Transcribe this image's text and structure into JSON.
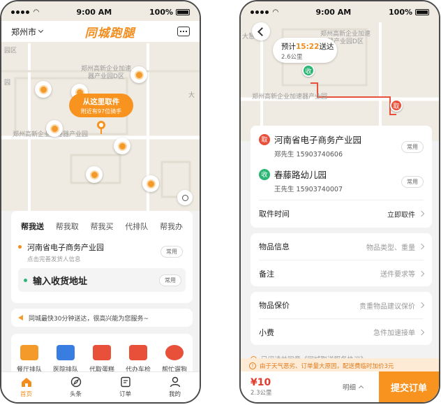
{
  "status": {
    "time": "9:00 AM",
    "battery": "100%"
  },
  "left": {
    "header": {
      "city": "郑州市",
      "brand": "同城跑腿"
    },
    "map": {
      "labels": [
        "郑州高新企业加速器产业园D区",
        "郑州高新企业加速器产业园",
        "园区",
        "园",
        "大"
      ],
      "pickup_title": "从这里取件",
      "pickup_sub": "附近有97位骑手"
    },
    "tabs": [
      "帮我送",
      "帮我取",
      "帮我买",
      "代排队",
      "帮我办"
    ],
    "sender": {
      "address": "河南省电子商务产业园",
      "hint": "点击完善发货人信息",
      "badge": "常用"
    },
    "receiver": {
      "placeholder": "输入收货地址",
      "badge": "常用"
    },
    "notice": "同城最快30分钟送达，很高兴能为您服务~",
    "services": [
      {
        "label": "餐厅排队",
        "color": "#f39a2b"
      },
      {
        "label": "医院排队",
        "color": "#3a7de0"
      },
      {
        "label": "代取蛋糕",
        "color": "#e8503a"
      },
      {
        "label": "代办车检",
        "color": "#e8503a"
      },
      {
        "label": "帮忙遛狗",
        "color": "#e8503a"
      }
    ],
    "nav": [
      {
        "label": "首页",
        "icon": "home-icon"
      },
      {
        "label": "头条",
        "icon": "compass-icon"
      },
      {
        "label": "订单",
        "icon": "order-icon"
      },
      {
        "label": "我的",
        "icon": "user-icon"
      }
    ]
  },
  "right": {
    "map": {
      "labels": [
        "郑州高新企业加速器产业园D区",
        "郑州高新企业加速器产业园",
        "大慧谷"
      ],
      "eta_prefix": "预计",
      "eta_time": "15:22",
      "eta_suffix": "送达",
      "eta_distance": "2.6公里",
      "marker_receive": "收",
      "marker_pickup": "取"
    },
    "pickup": {
      "tag": "取",
      "name": "河南省电子商务产业园",
      "contact": "郑先生   15903740606",
      "badge": "常用"
    },
    "dropoff": {
      "tag": "收",
      "name": "春藤路幼儿园",
      "contact": "王先生   15903740007",
      "badge": "常用"
    },
    "pickup_time": {
      "label": "取件时间",
      "value": "立即取件"
    },
    "item_info": {
      "label": "物品信息",
      "value": "物品类型、重量"
    },
    "remark": {
      "label": "备注",
      "value": "送件要求等"
    },
    "insurance": {
      "label": "物品保价",
      "value": "贵重物品建议保价"
    },
    "tip": {
      "label": "小费",
      "value": "急件加速接单"
    },
    "agreement": "已阅读并同意《同城取送服务协议》",
    "warning": "由于天气恶劣、订单量大原因，配送费临时加价3元",
    "price": "¥10",
    "distance": "2.3公里",
    "detail": "明细",
    "submit": "提交订单"
  }
}
